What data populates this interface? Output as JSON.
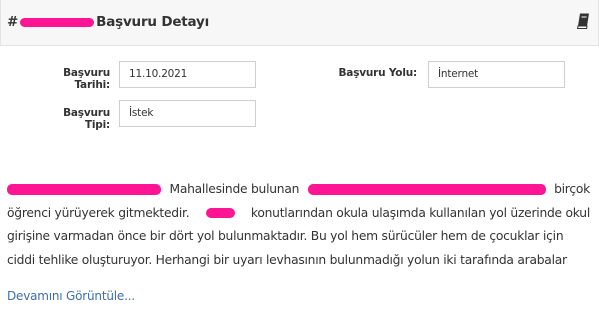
{
  "header": {
    "title_prefix": "#",
    "title": "Başvuru Detayı",
    "icon": "book-icon"
  },
  "form": {
    "date_label": "Başvuru Tarihi:",
    "date_value": "11.10.2021",
    "channel_label": "Başvuru Yolu:",
    "channel_value": "İnternet",
    "type_label": "Başvuru Tipi:",
    "type_value": "İstek"
  },
  "body": {
    "line1_mid": "Mahallesinde bulunan",
    "line1_end": "birçok",
    "line2_a": "öğrenci yürüyerek gitmektedir.",
    "line2_b": "konutlarından okula ulaşımda kullanılan yol üzerinde okul",
    "line3": "girişine varmadan önce bir dört yol bulunmaktadır. Bu yol hem sürücüler hem de çocuklar için",
    "line4": "ciddi tehlike oluşturuyor. Herhangi bir uyarı levhasının bulunmadığı yolun iki tarafında arabalar",
    "more_link": "Devamını Görüntüle..."
  },
  "colors": {
    "redaction": "#ff1493",
    "link": "#3d6fa7",
    "header_bg": "#f7f7f7"
  }
}
